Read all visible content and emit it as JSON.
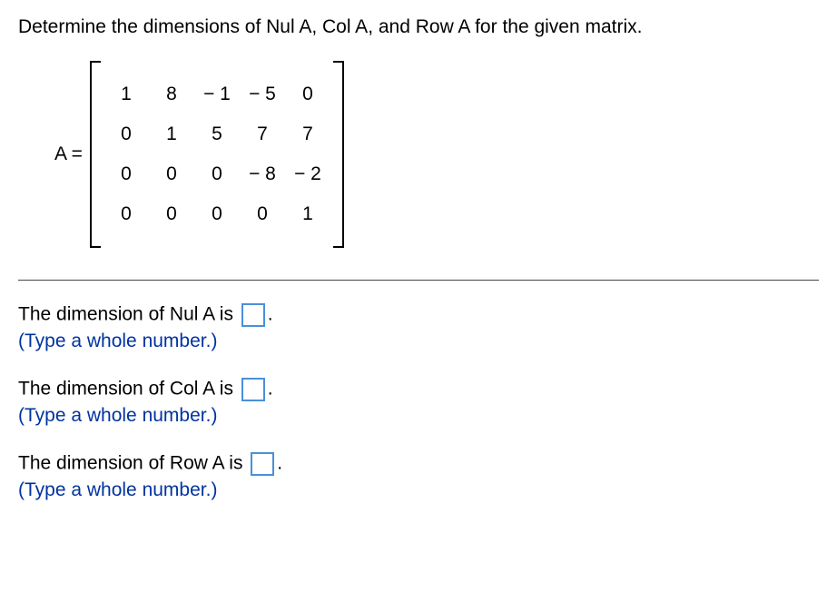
{
  "question": "Determine the dimensions of Nul A, Col A, and Row A for the given matrix.",
  "matrix": {
    "label": "A =",
    "rows": [
      [
        "1",
        "8",
        "− 1",
        "− 5",
        "0"
      ],
      [
        "0",
        "1",
        "5",
        "7",
        "7"
      ],
      [
        "0",
        "0",
        "0",
        "− 8",
        "− 2"
      ],
      [
        "0",
        "0",
        "0",
        "0",
        "1"
      ]
    ]
  },
  "answers": [
    {
      "prompt_pre": "The dimension of Nul A is ",
      "prompt_post": ".",
      "hint": "(Type a whole number.)"
    },
    {
      "prompt_pre": "The dimension of Col A is ",
      "prompt_post": ".",
      "hint": "(Type a whole number.)"
    },
    {
      "prompt_pre": "The dimension of Row A is ",
      "prompt_post": ".",
      "hint": "(Type a whole number.)"
    }
  ]
}
